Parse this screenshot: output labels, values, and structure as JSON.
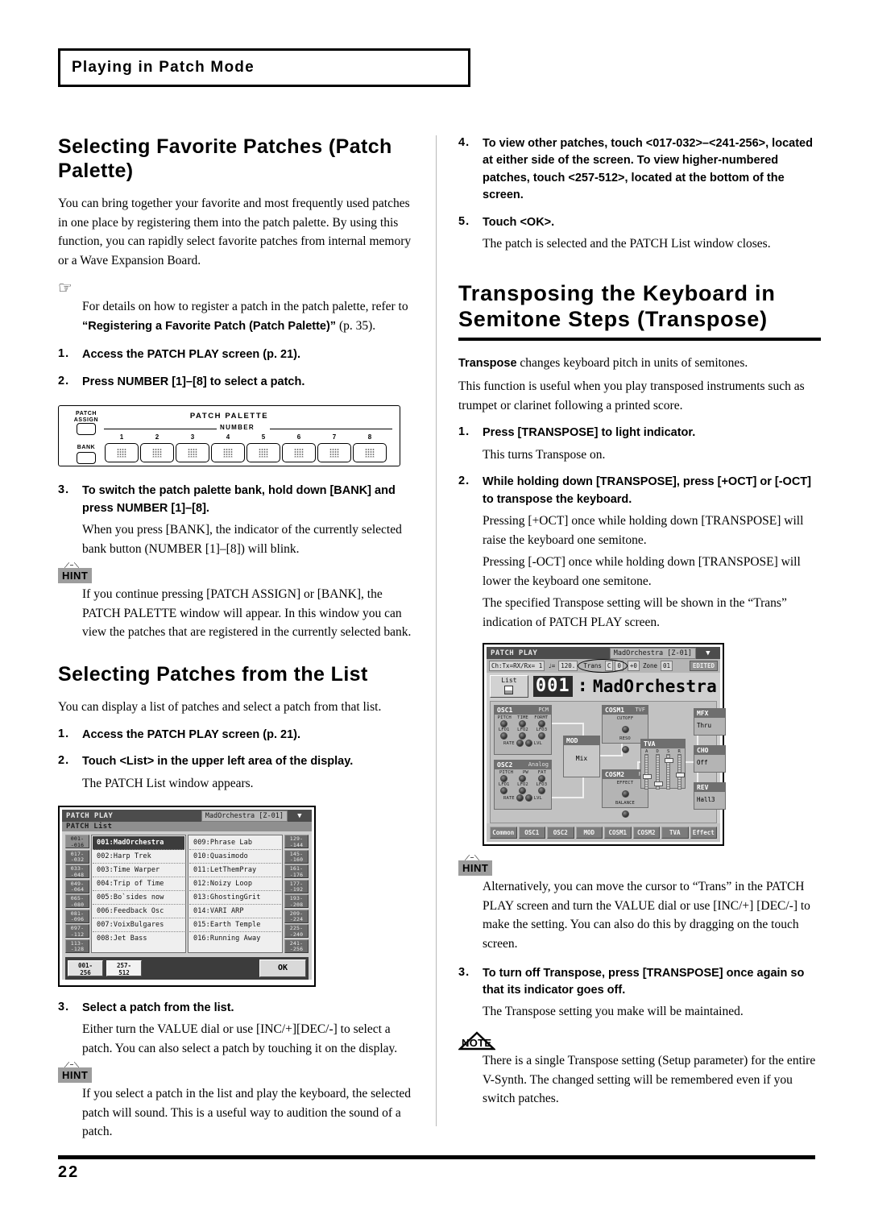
{
  "running_head": "Playing in Patch Mode",
  "page_number": "22",
  "left_column": {
    "heading_favorite": "Selecting Favorite Patches (Patch Palette)",
    "intro": "You can bring together your favorite and most frequently used patches in one place by registering them into the patch palette. By using this function, you can rapidly select favorite patches from internal memory or a Wave Expansion Board.",
    "hand_icon": "☞",
    "ref_pre": "For details on how to register a patch in the patch palette, refer to ",
    "ref_bold": "“Registering a Favorite Patch (Patch Palette)”",
    "ref_post": " (p. 35).",
    "step1_num": "1.",
    "step1_title": "Access the PATCH PLAY screen (p. 21).",
    "step2_num": "2.",
    "step2_title": "Press NUMBER [1]–[8] to select a patch.",
    "step3_num": "3.",
    "step3_title": "To switch the patch palette bank, hold down [BANK] and press NUMBER [1]–[8].",
    "step3_desc": "When you press [BANK], the indicator of the currently selected bank button (NUMBER [1]–[8]) will blink.",
    "hint1_label": "HINT",
    "hint1_text": "If you continue pressing [PATCH ASSIGN] or [BANK], the PATCH PALETTE window will appear. In this window you can view the patches that are registered in the currently selected bank.",
    "heading_list": "Selecting Patches from the List",
    "list_intro": "You can display a list of patches and select a patch from that list.",
    "lstep1_num": "1.",
    "lstep1_title": "Access the PATCH PLAY screen (p. 21).",
    "lstep2_num": "2.",
    "lstep2_title": "Touch <List> in the upper left area of the display.",
    "lstep2_desc": "The PATCH List window appears.",
    "lstep3_num": "3.",
    "lstep3_title": "Select a patch from the list.",
    "lstep3_desc": "Either turn the VALUE dial or use [INC/+][DEC/-] to select a patch. You can also select a patch by touching it on the display.",
    "hint2_label": "HINT",
    "hint2_text": "If you select a patch in the list and play the keyboard, the selected patch will sound. This is a useful way to audition the sound of a patch."
  },
  "palette_figure": {
    "patch_assign_label": "PATCH\nASSIGN",
    "title": "PATCH PALETTE",
    "bank_label": "BANK",
    "number_label": "NUMBER",
    "button_numbers": [
      "1",
      "2",
      "3",
      "4",
      "5",
      "6",
      "7",
      "8"
    ]
  },
  "patch_list_screen": {
    "title": "PATCH PLAY",
    "patch_name_field": "MadOrchestra [Z-01]",
    "dropdown_icon": "▼",
    "subtitle": "PATCH List",
    "left_range_buttons": [
      "001-\n-016",
      "017-\n-032",
      "033-\n-048",
      "049-\n-064",
      "065-\n-080",
      "081-\n-096",
      "097-\n-112",
      "113-\n-128"
    ],
    "right_range_buttons": [
      "129-\n-144",
      "145-\n-160",
      "161-\n-176",
      "177-\n-192",
      "193-\n-208",
      "209-\n-224",
      "225-\n-240",
      "241-\n-256"
    ],
    "left_patches": [
      "001:MadOrchestra",
      "002:Harp Trek",
      "003:Time Warper",
      "004:Trip of Time",
      "005:Bo`sides now",
      "006:Feedback Osc",
      "007:VoixBulgares",
      "008:Jet Bass"
    ],
    "right_patches": [
      "009:Phrase Lab",
      "010:Quasimodo",
      "011:LetThemPray",
      "012:Noizy Loop",
      "013:GhostingGrit",
      "014:VARI ARP",
      "015:Earth Temple",
      "016:Running Away"
    ],
    "footer_button_1": "001-\n256",
    "footer_button_2": "257-\n512",
    "ok_label": "OK"
  },
  "patch_play_screen": {
    "title": "PATCH PLAY",
    "patch_name_field": "MadOrchestra [Z-01]",
    "dropdown_icon": "▼",
    "channel": "Ch:Tx=RX/Rx= 1",
    "tempo_icon": "♩=",
    "tempo": "120.",
    "trans_label": "Trans",
    "trans_note": "C",
    "trans_oct": "0",
    "oct_value": "+0",
    "zone_label": "Zone",
    "zone_value": "01",
    "edited_badge": "EDITED",
    "list_button": "List",
    "patch_number": "001",
    "patch_separator": ":",
    "patch_name": "MadOrchestra",
    "blocks": {
      "osc1": {
        "name": "OSC1",
        "sub": "PCM",
        "row1": [
          "PITCH",
          "TIME",
          "FORMT"
        ],
        "row2": [
          "LFO1",
          "LFO2",
          "LFO3"
        ],
        "row3_left": "RATE",
        "row3_right": "LVL"
      },
      "osc2": {
        "name": "OSC2",
        "sub": "Analog",
        "row1": [
          "PITCH",
          "PW",
          "FAT"
        ],
        "row2": [
          "LFO1",
          "LFO2",
          "LFO3"
        ],
        "row3_left": "RATE",
        "row3_right": "LVL"
      },
      "mod": {
        "name": "MOD",
        "value": "Mix"
      },
      "cosm1": {
        "name": "COSM1",
        "sub": "TVF",
        "p1": "CUTOFF",
        "p2": "RESO"
      },
      "cosm2": {
        "name": "COSM2",
        "sub": "FS",
        "p1": "EFFECT",
        "p2": "BALANCE"
      },
      "tva": {
        "name": "TVA",
        "faders": [
          "A",
          "D",
          "S",
          "R"
        ]
      },
      "mfx": {
        "name": "MFX",
        "value": "Thru"
      },
      "cho": {
        "name": "CHO",
        "value": "Off"
      },
      "rev": {
        "name": "REV",
        "value": "Hall3"
      }
    },
    "tabs": [
      "Common",
      "OSC1",
      "OSC2",
      "MOD",
      "COSM1",
      "COSM2",
      "TVA",
      "Effect"
    ]
  },
  "right_column": {
    "step4_num": "4.",
    "step4_title": "To view other patches, touch <017-032>–<241-256>, located at either side of the screen. To view higher-numbered patches, touch <257-512>, located at the bottom of the screen.",
    "step5_num": "5.",
    "step5_title": "Touch <OK>.",
    "step5_desc": "The patch is selected and the PATCH List window closes.",
    "heading_transpose": "Transposing the Keyboard in Semitone Steps (Transpose)",
    "intro_bold": "Transpose",
    "intro_rest": " changes keyboard pitch in units of semitones.",
    "intro_p2": "This function is useful when you play transposed instruments such as trumpet or clarinet following a printed score.",
    "tstep1_num": "1.",
    "tstep1_title": "Press [TRANSPOSE] to light indicator.",
    "tstep1_desc": "This turns Transpose on.",
    "tstep2_num": "2.",
    "tstep2_title": "While holding down [TRANSPOSE], press [+OCT] or [-OCT] to transpose the keyboard.",
    "tstep2_desc1": "Pressing [+OCT] once while holding down [TRANSPOSE] will raise the keyboard one semitone.",
    "tstep2_desc2": "Pressing [-OCT] once while holding down [TRANSPOSE] will lower the keyboard one semitone.",
    "tstep2_desc3": "The specified Transpose setting will be shown in the “Trans” indication of PATCH PLAY screen.",
    "hint3_label": "HINT",
    "hint3_text": "Alternatively, you can move the cursor to “Trans” in the PATCH PLAY screen and turn the VALUE dial or use [INC/+] [DEC/-] to make the setting. You can also do this by dragging on the touch screen.",
    "tstep3_num": "3.",
    "tstep3_title": "To turn off Transpose, press [TRANSPOSE] once again so that its indicator goes off.",
    "tstep3_desc": "The Transpose setting you make will be maintained.",
    "note_label": "NOTE",
    "note_text": "There is a single Transpose setting (Setup parameter) for the entire V-Synth. The changed setting will be remembered even if you switch patches."
  }
}
